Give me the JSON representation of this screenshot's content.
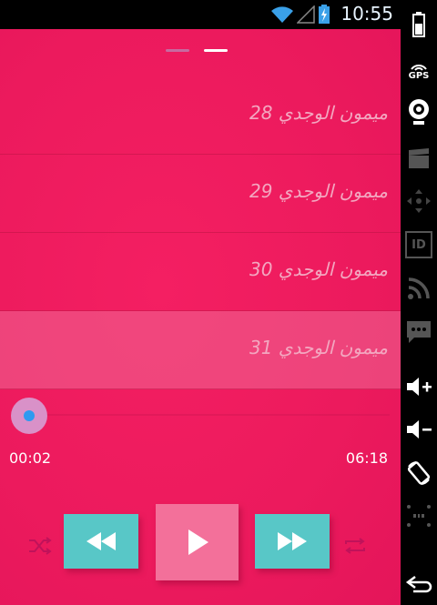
{
  "status_bar": {
    "time": "10:55",
    "icons": [
      "wifi-icon",
      "signal-icon",
      "battery-charging-icon"
    ]
  },
  "sidebar": {
    "gps_label": "GPS",
    "id_label": "ID",
    "items": [
      "battery-icon",
      "gps-icon",
      "camera-icon",
      "clapperboard-icon",
      "dpad-icon",
      "id-icon",
      "rss-icon",
      "message-icon",
      "volume-up-icon",
      "volume-down-icon",
      "rotate-icon",
      "scale-icon",
      "back-icon"
    ]
  },
  "pager": {
    "count": 2,
    "active_index": 1
  },
  "playlist": {
    "items": [
      {
        "title": "ميمون الوجدي 28",
        "active": false
      },
      {
        "title": "ميمون الوجدي 29",
        "active": false
      },
      {
        "title": "ميمون الوجدي 30",
        "active": false
      },
      {
        "title": "ميمون الوجدي 31",
        "active": true
      }
    ]
  },
  "player": {
    "current_time": "00:02",
    "total_time": "06:18",
    "progress": 0.005
  },
  "colors": {
    "background": "#ec1a5d",
    "teal_button": "#58c7c7",
    "play_button": "#f3709a",
    "seek_thumb": "#d991c8",
    "seek_core": "#2e9af0",
    "row_text": "#f3a7c0"
  }
}
